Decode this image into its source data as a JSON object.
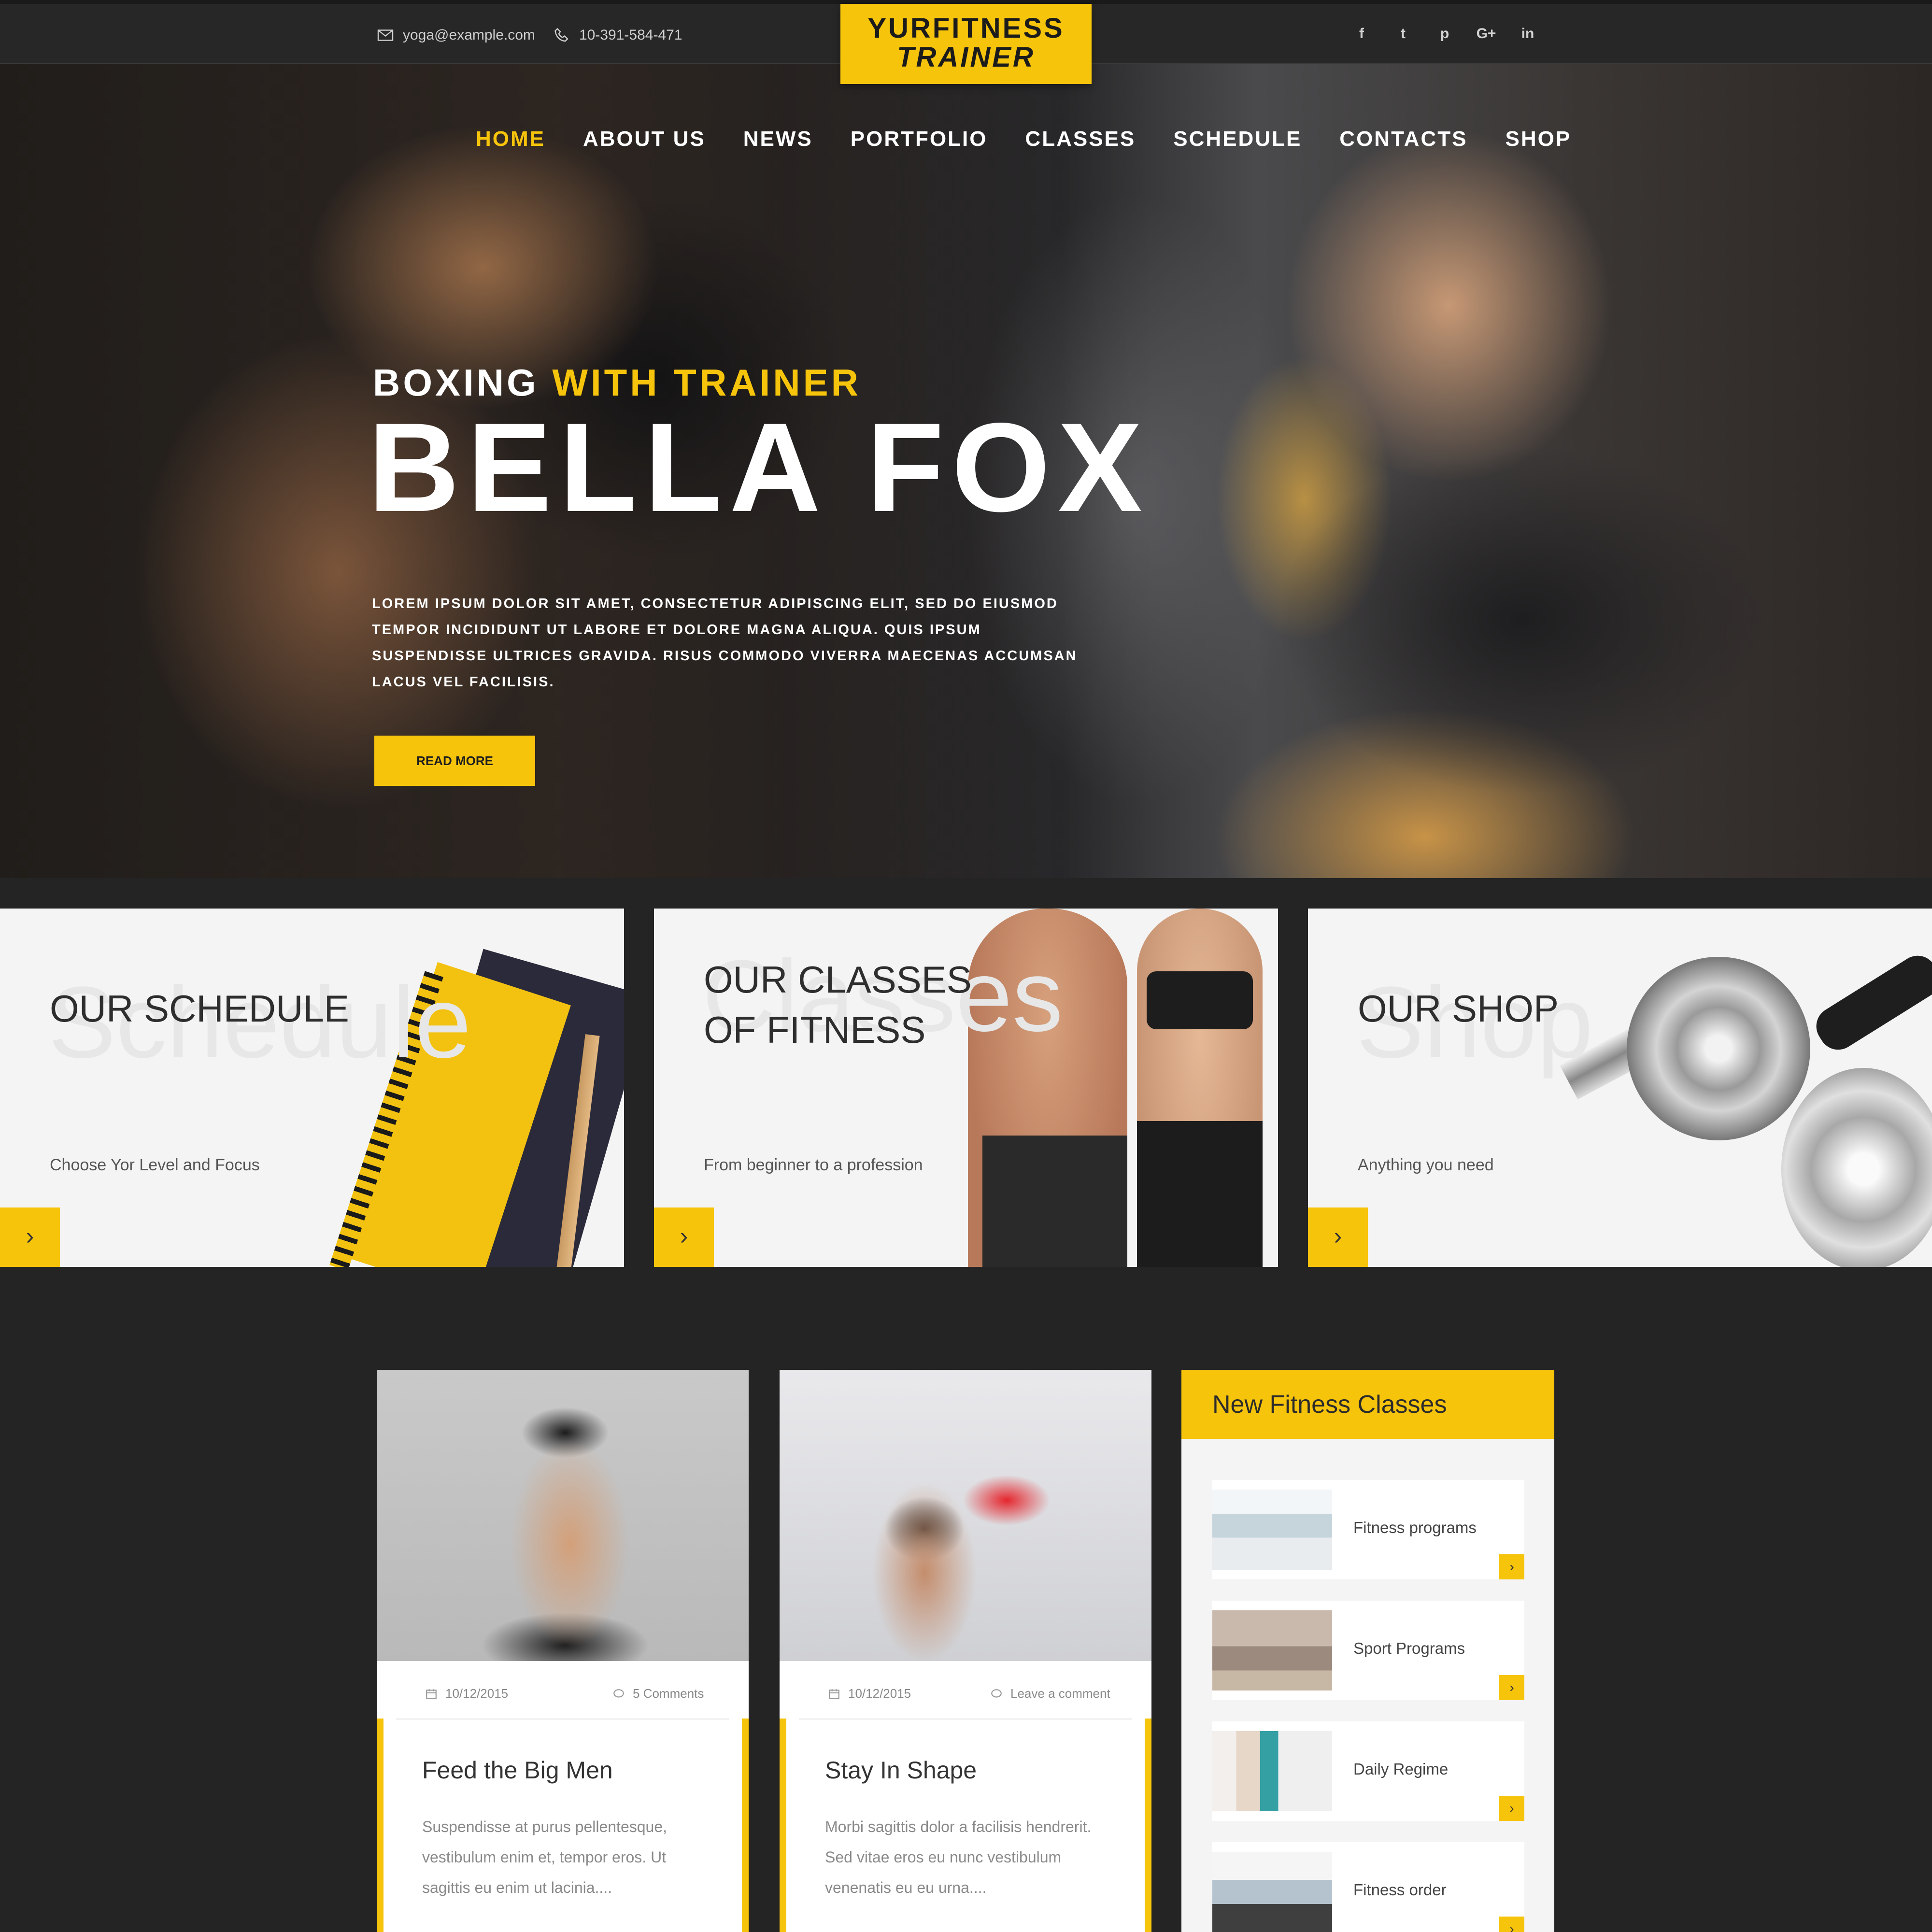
{
  "topbar": {
    "email": "yoga@example.com",
    "phone": "10-391-584-471",
    "email_icon": "envelope-icon",
    "phone_icon": "phone-icon",
    "social": [
      {
        "name": "facebook-icon",
        "glyph": "f"
      },
      {
        "name": "twitter-icon",
        "glyph": "t"
      },
      {
        "name": "pinterest-icon",
        "glyph": "p"
      },
      {
        "name": "google-plus-icon",
        "glyph": "G+"
      },
      {
        "name": "linkedin-icon",
        "glyph": "in"
      }
    ]
  },
  "logo": {
    "line1": "YURFITNESS",
    "line2": "TRAINER"
  },
  "nav": {
    "items": [
      "HOME",
      "ABOUT US",
      "NEWS",
      "PORTFOLIO",
      "CLASSES",
      "SCHEDULE",
      "CONTACTS",
      "SHOP"
    ],
    "active": "HOME"
  },
  "hero": {
    "kicker_white": "BOXING",
    "kicker_yellow": "WITH TRAINER",
    "title": "BELLA FOX",
    "text": "LOREM IPSUM DOLOR SIT AMET, CONSECTETUR ADIPISCING ELIT, SED DO EIUSMOD TEMPOR INCIDIDUNT UT LABORE ET DOLORE MAGNA ALIQUA. QUIS IPSUM SUSPENDISSE ULTRICES GRAVIDA. RISUS COMMODO VIVERRA MAECENAS ACCUMSAN LACUS VEL FACILISIS.",
    "button": "READ MORE"
  },
  "cards": [
    {
      "ghost": "Schedule",
      "title_lines": [
        "OUR SCHEDULE"
      ],
      "subtitle": "Choose Yor Level and Focus",
      "arrow": "›"
    },
    {
      "ghost": "Classes",
      "title_lines": [
        "OUR CLASSES",
        "OF FITNESS"
      ],
      "subtitle": "From beginner to a profession",
      "arrow": "›"
    },
    {
      "ghost": "Shop",
      "title_lines": [
        "OUR SHOP"
      ],
      "subtitle": "Anything you need",
      "arrow": "›"
    }
  ],
  "posts": [
    {
      "date": "10/12/2015",
      "comments": "5 Comments",
      "title": "Feed the Big Men",
      "body": "Suspendisse at purus pellentesque, vestibulum enim et, tempor eros. Ut sagittis eu enim ut lacinia...."
    },
    {
      "date": "10/12/2015",
      "comments": "Leave a comment",
      "title": "Stay In Shape",
      "body": "Morbi sagittis dolor a facilisis hendrerit. Sed vitae eros eu nunc vestibulum venenatis eu eu urna...."
    }
  ],
  "widget": {
    "title": "New Fitness Classes",
    "items": [
      "Fitness programs",
      "Sport Programs",
      "Daily Regime",
      "Fitness order"
    ],
    "arrow": "›"
  },
  "colors": {
    "accent": "#f7c40c",
    "dark": "#242424",
    "card_bg": "#f4f4f4"
  }
}
